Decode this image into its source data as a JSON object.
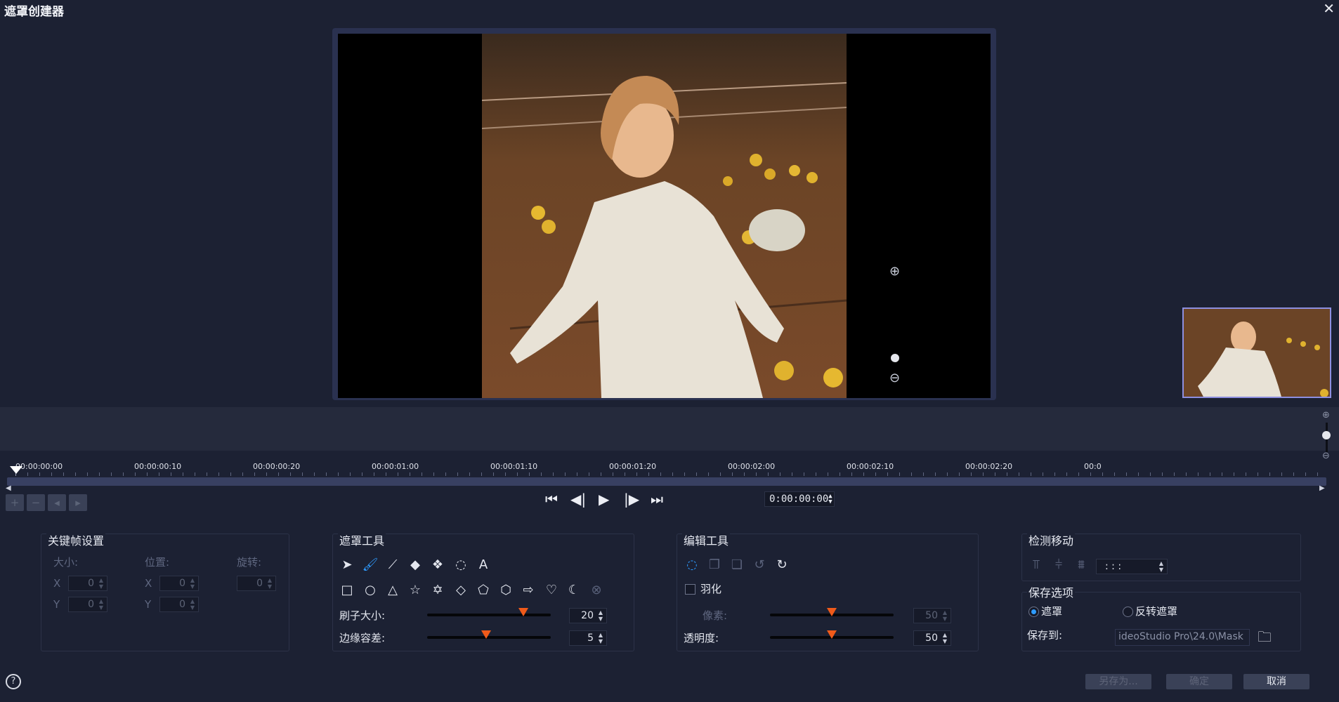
{
  "window": {
    "title": "遮罩创建器",
    "close_glyph": "✕"
  },
  "preview": {
    "zoom_in_icon": "zoom-in-icon",
    "zoom_out_icon": "zoom-out-icon"
  },
  "timeline": {
    "labels": [
      "00:00:00:00",
      "00:00:00:10",
      "00:00:00:20",
      "00:00:01:00",
      "00:00:01:10",
      "00:00:01:20",
      "00:00:02:00",
      "00:00:02:10",
      "00:00:02:20",
      "00:0"
    ]
  },
  "timecode": {
    "value": "0:00:00:00"
  },
  "keyframe_panel": {
    "title": "关键帧设置",
    "size_label": "大小:",
    "position_label": "位置:",
    "rotation_label": "旋转:",
    "x_label": "X",
    "y_label": "Y",
    "size_x": "0",
    "size_y": "0",
    "pos_x": "0",
    "pos_y": "0",
    "rotation": "0"
  },
  "mask_tools": {
    "title": "遮罩工具",
    "brush_size_label": "刷子大小:",
    "brush_size": "20",
    "brush_size_level": 0.78,
    "edge_tol_label": "边缘容差:",
    "edge_tol": "5",
    "edge_tol_level": 0.48,
    "text_tool_glyph": "A"
  },
  "edit_tools": {
    "title": "编辑工具",
    "feather_label": "羽化",
    "pixel_label": "像素:",
    "pixel_value": "50",
    "pixel_level": 0.5,
    "opacity_label": "透明度:",
    "opacity_value": "50",
    "opacity_level": 0.5
  },
  "motion": {
    "title": "检测移动",
    "time_value": ":  :  :"
  },
  "save_options": {
    "title": "保存选项",
    "mask_label": "遮罩",
    "invert_label": "反转遮罩",
    "save_to_label": "保存到:",
    "save_path": "ideoStudio Pro\\24.0\\Mask"
  },
  "buttons": {
    "save_as": "另存为...",
    "ok": "确定",
    "cancel": "取消",
    "help": "?"
  },
  "colors": {
    "accent": "#2e9bff",
    "slider_knob": "#f05a1a",
    "background": "#1c2133"
  }
}
